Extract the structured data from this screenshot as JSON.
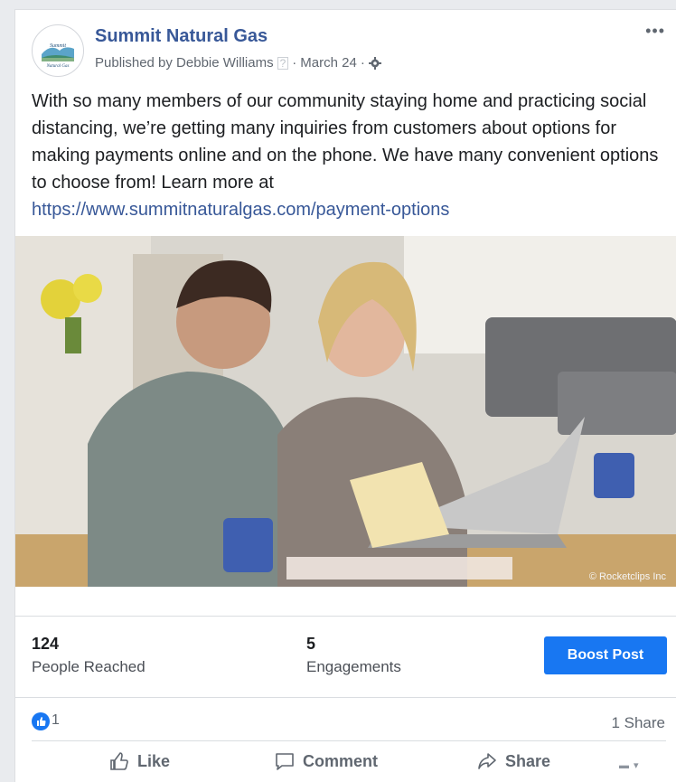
{
  "post": {
    "page_name": "Summit Natural Gas",
    "published_by": "Published by Debbie Williams",
    "help_mark": "?",
    "separator": "·",
    "date": "March 24",
    "body": "With so many members of our community staying home and practicing social distancing, we’re getting many inquiries from customers about options for making payments online and on the phone. We have many convenient options to choose from! Learn more at",
    "link": "https://www.summitnaturalgas.com/payment-options",
    "image_credit": "© Rocketclips Inc"
  },
  "avatar": {
    "logo_text_1": "Summit",
    "logo_text_2": "Natural Gas"
  },
  "stats": {
    "reached_value": "124",
    "reached_label": "People Reached",
    "engagements_value": "5",
    "engagements_label": "Engagements",
    "boost_label": "Boost Post"
  },
  "reactions": {
    "like_count": "1",
    "shares": "1 Share"
  },
  "actions": {
    "like": "Like",
    "comment": "Comment",
    "share": "Share"
  },
  "colors": {
    "accent": "#1877f2",
    "link": "#385898",
    "text": "#1c1e21",
    "muted": "#606770"
  },
  "icons": [
    "more-options-icon",
    "settings-gear-icon",
    "like-thumb-icon",
    "comment-bubble-icon",
    "share-arrow-icon",
    "audience-dropdown-icon"
  ]
}
